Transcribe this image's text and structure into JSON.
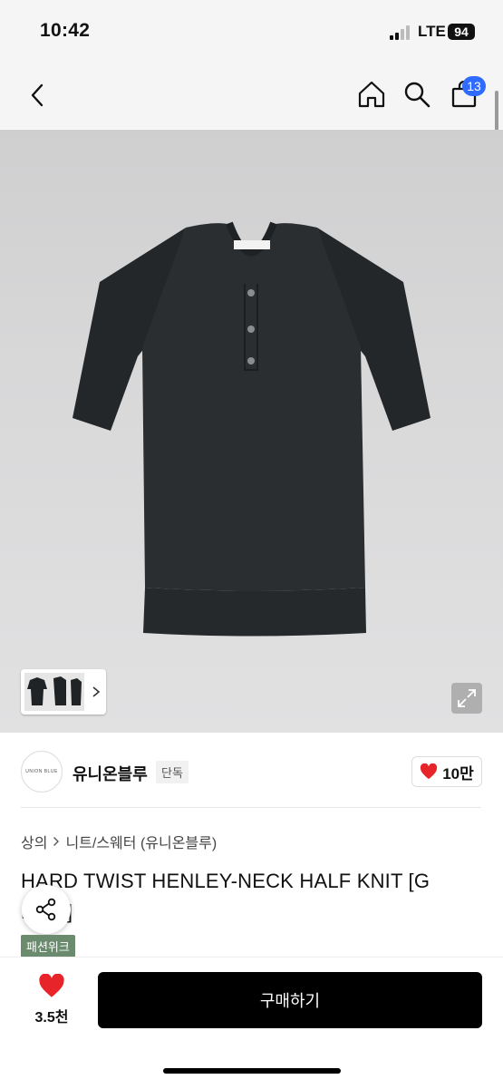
{
  "status": {
    "time": "10:42",
    "network": "LTE",
    "battery": "94"
  },
  "nav": {
    "cart_count": "13"
  },
  "brand": {
    "logo_text": "UNION BLUE",
    "name": "유니온블루",
    "exclusive": "단독",
    "likes": "10만"
  },
  "breadcrumbs": [
    "상의",
    "니트/스웨터 (유니온블루)"
  ],
  "product": {
    "title": "HARD TWIST HENLEY-NECK HALF KNIT [G    HITE]",
    "tag": "패션위크"
  },
  "bottom": {
    "heart_count": "3.5천",
    "buy_label": "구매하기"
  },
  "colors": {
    "accent": "#2f6bff",
    "heart": "#e8242b",
    "tag_bg": "#6a8b6e",
    "buy_bg": "#000000",
    "shirt": "#24282a"
  },
  "icons": [
    "back-icon",
    "home-icon",
    "search-icon",
    "cart-icon",
    "expand-icon",
    "share-icon",
    "heart-icon",
    "chevron-right-icon"
  ]
}
